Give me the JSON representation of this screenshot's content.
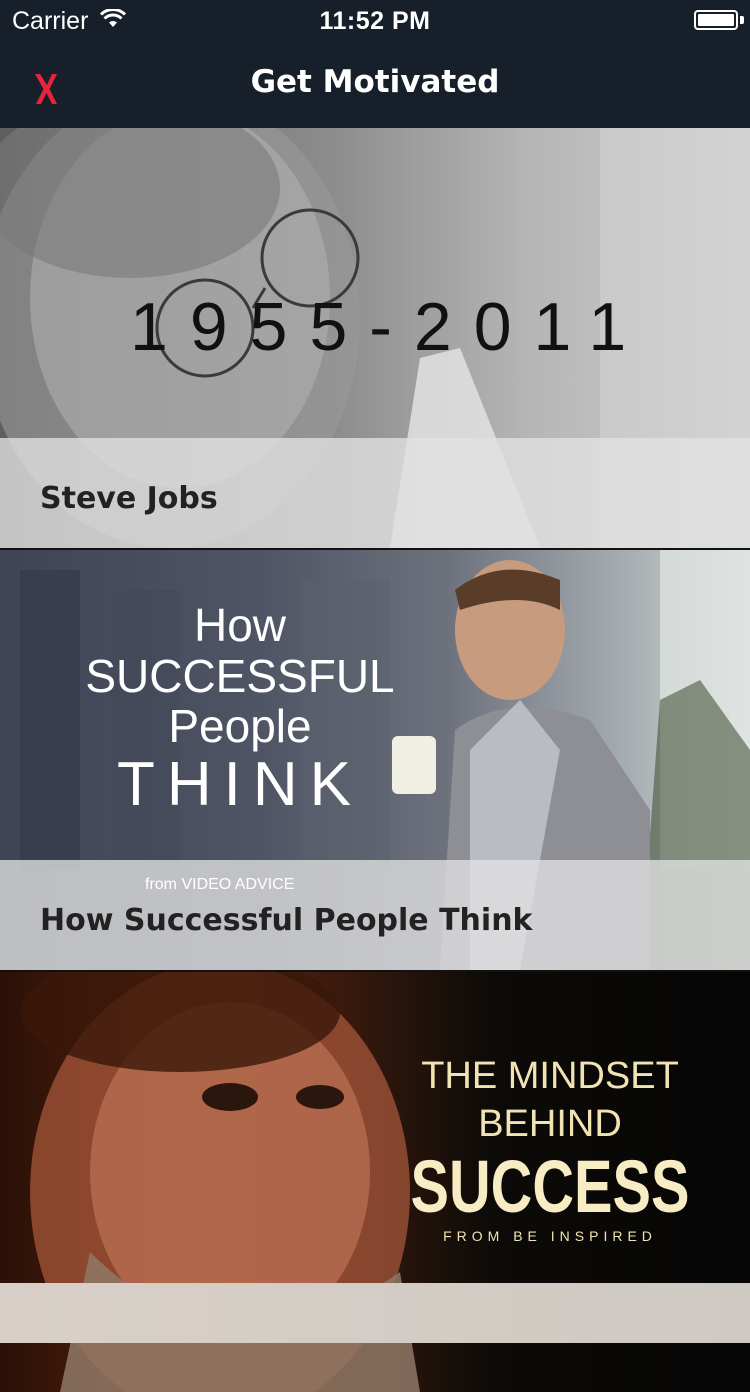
{
  "status_bar": {
    "carrier": "Carrier",
    "time": "11:52 PM",
    "icons": [
      "wifi-icon",
      "battery-icon"
    ]
  },
  "nav": {
    "title": "Get Motivated",
    "close_icon": "close-x-icon",
    "close_color": "#e8243c"
  },
  "videos": [
    {
      "title": "Steve Jobs",
      "thumbnail_text": "1955-2011"
    },
    {
      "title": "How Successful People Think",
      "subtitle": "from VIDEO ADVICE",
      "thumbnail_lines": [
        "How",
        "SUCCESSFUL",
        "People",
        "THINK"
      ]
    },
    {
      "title": "",
      "thumbnail_lines": [
        "THE MINDSET BEHIND",
        "SUCCESS",
        "FROM BE INSPIRED"
      ]
    }
  ],
  "colors": {
    "nav_background": "#17202a",
    "caption_overlay": "#e1e1e1",
    "accent_red": "#e8243c",
    "mindset_gold": "#f1e3b4"
  }
}
